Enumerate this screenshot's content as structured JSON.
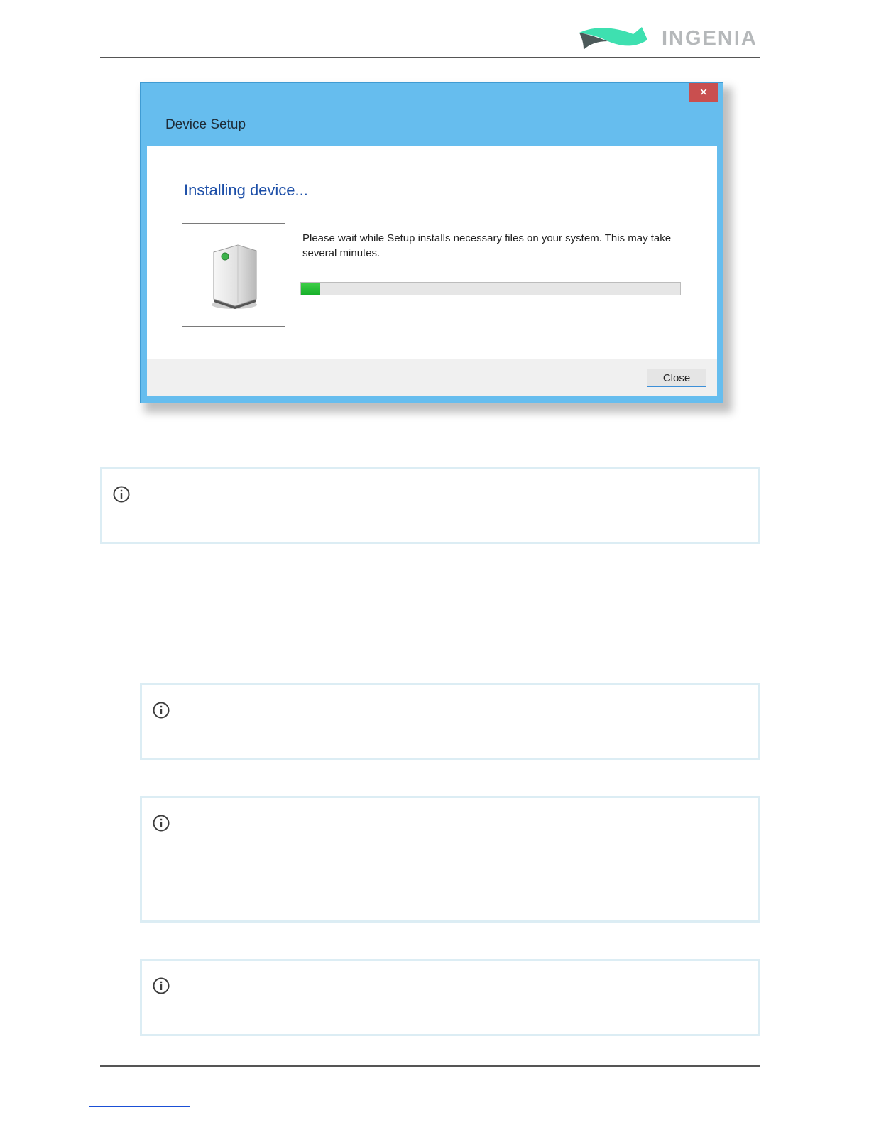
{
  "header": {
    "brand_name": "INGENIA",
    "colors": {
      "brand_teal": "#3ee0b0",
      "brand_dark": "#4c5a5a",
      "brand_text": "#b5b8ba"
    }
  },
  "dialog": {
    "title": "Device Setup",
    "close_icon_glyph": "✕",
    "heading": "Installing device...",
    "message": "Please wait while Setup installs necessary files on your system. This may take several minutes.",
    "progress_percent": 5,
    "close_button_label": "Close",
    "icon": "device-tower-icon",
    "colors": {
      "titlebar": "#66bdee",
      "close": "#c94f4f",
      "heading": "#1d4fa8",
      "progress": "#22b833"
    }
  },
  "info_panels": [
    {
      "icon": "info-circle-icon"
    },
    {
      "icon": "info-circle-icon"
    },
    {
      "icon": "info-circle-icon"
    },
    {
      "icon": "info-circle-icon"
    }
  ]
}
